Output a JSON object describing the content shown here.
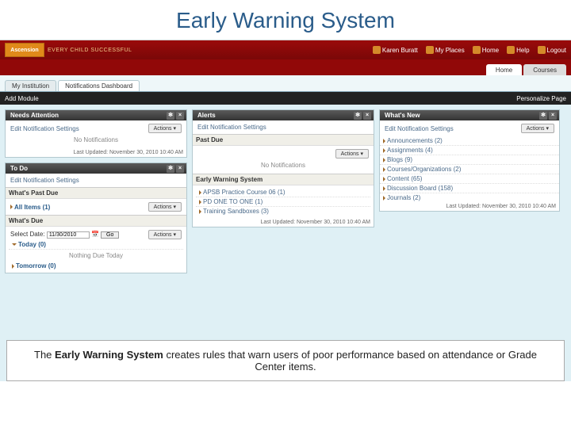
{
  "slide_title": "Early Warning System",
  "logo_text": "Ascension",
  "tagline": "EVERY CHILD SUCCESSFUL",
  "top_links": [
    {
      "label": "Karen Buratt"
    },
    {
      "label": "My Places"
    },
    {
      "label": "Home"
    },
    {
      "label": "Help"
    },
    {
      "label": "Logout"
    }
  ],
  "main_tabs": [
    {
      "label": "Home",
      "active": true
    },
    {
      "label": "Courses",
      "active": false
    }
  ],
  "sub_tabs": [
    {
      "label": "My Institution",
      "active": false
    },
    {
      "label": "Notifications Dashboard",
      "active": true
    }
  ],
  "toolbar_left": "Add Module",
  "toolbar_right": "Personalize Page",
  "actions_label": "Actions ▾",
  "needs": {
    "title": "Needs Attention",
    "settings": "Edit Notification Settings",
    "empty": "No Notifications",
    "updated": "Last Updated: November 30, 2010 10:40 AM"
  },
  "alerts": {
    "title": "Alerts",
    "settings": "Edit Notification Settings",
    "pastdue_hd": "Past Due",
    "pastdue_empty": "No Notifications",
    "ews_hd": "Early Warning System",
    "items": [
      {
        "label": "APSB Practice Course 06 (1)"
      },
      {
        "label": "PD ONE TO ONE (1)"
      },
      {
        "label": "Training Sandboxes (3)"
      }
    ],
    "updated": "Last Updated: November 30, 2010 10:40 AM"
  },
  "whatsnew": {
    "title": "What's New",
    "settings": "Edit Notification Settings",
    "items": [
      {
        "label": "Announcements (2)"
      },
      {
        "label": "Assignments (4)"
      },
      {
        "label": "Blogs (9)"
      },
      {
        "label": "Courses/Organizations (2)"
      },
      {
        "label": "Content (65)"
      },
      {
        "label": "Discussion Board (158)"
      },
      {
        "label": "Journals (2)"
      }
    ],
    "updated": "Last Updated: November 30, 2010 10:40 AM"
  },
  "todo": {
    "title": "To Do",
    "settings": "Edit Notification Settings",
    "pastdue_hd": "What's Past Due",
    "pastdue_item": "All Items (1)",
    "due_hd": "What's Due",
    "select_label": "Select Date:",
    "date_value": "11/30/2010",
    "go": "Go",
    "today": "Today (0)",
    "today_empty": "Nothing Due Today",
    "tomorrow": "Tomorrow (0)"
  },
  "caption_bold": "Early Warning System",
  "caption_prefix": "The ",
  "caption_rest": " creates rules that warn users of poor performance based on attendance or Grade Center items."
}
